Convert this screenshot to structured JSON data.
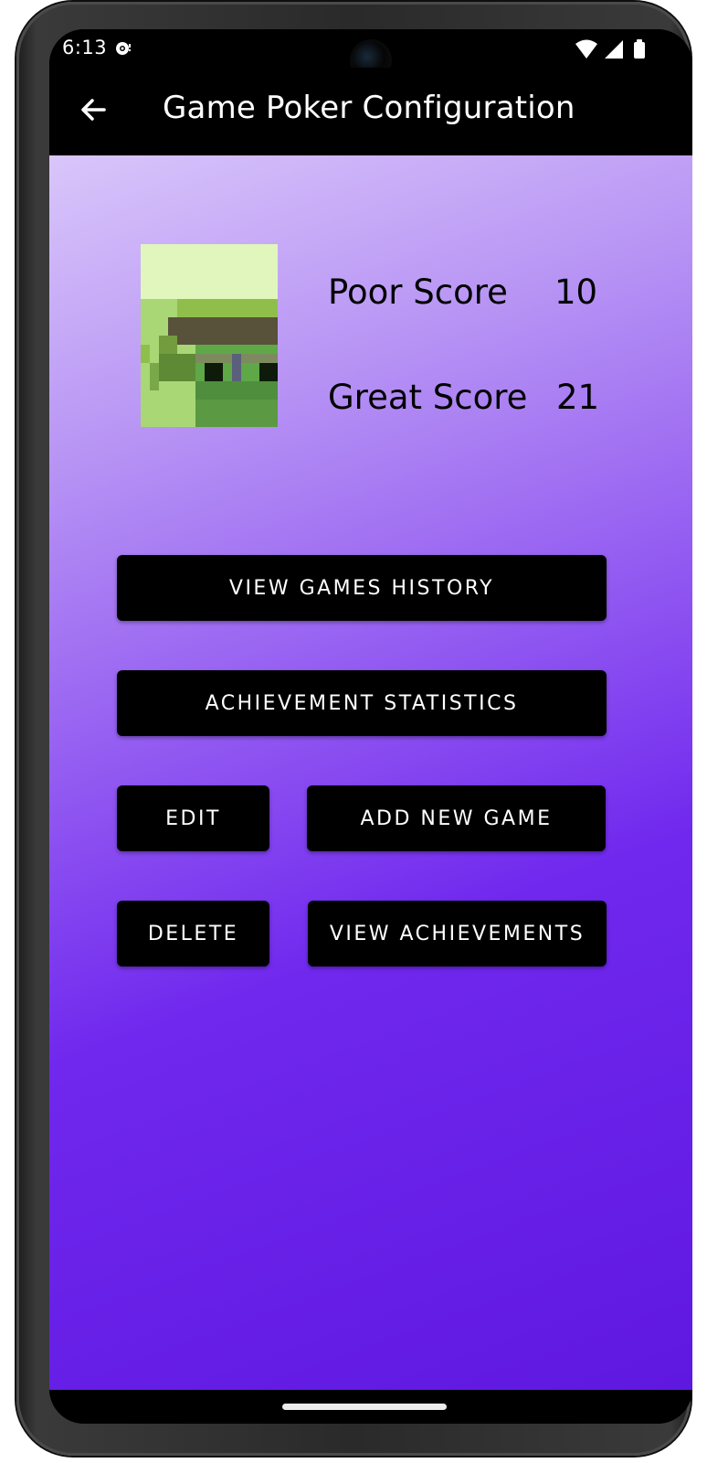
{
  "status_bar": {
    "time": "6:13",
    "notification_icon": "podcast-icon",
    "wifi_icon": "wifi-icon",
    "signal_icon": "signal-icon",
    "battery_icon": "battery-icon"
  },
  "app_bar": {
    "title": "Game Poker Configuration",
    "back_icon": "arrow-back-icon"
  },
  "scores": {
    "poor_label": "Poor Score",
    "poor_value": "10",
    "great_label": "Great Score",
    "great_value": "21"
  },
  "buttons": {
    "view_games_history": "VIEW GAMES HISTORY",
    "achievement_statistics": "ACHIEVEMENT STATISTICS",
    "edit": "EDIT",
    "add_new_game": "ADD NEW GAME",
    "delete": "DELETE",
    "view_achievements": "VIEW ACHIEVEMENTS"
  },
  "colors": {
    "gradient_top": "#d9c6fa",
    "gradient_bottom": "#5f18e0",
    "button_bg": "#000000",
    "button_text": "#ffffff"
  }
}
